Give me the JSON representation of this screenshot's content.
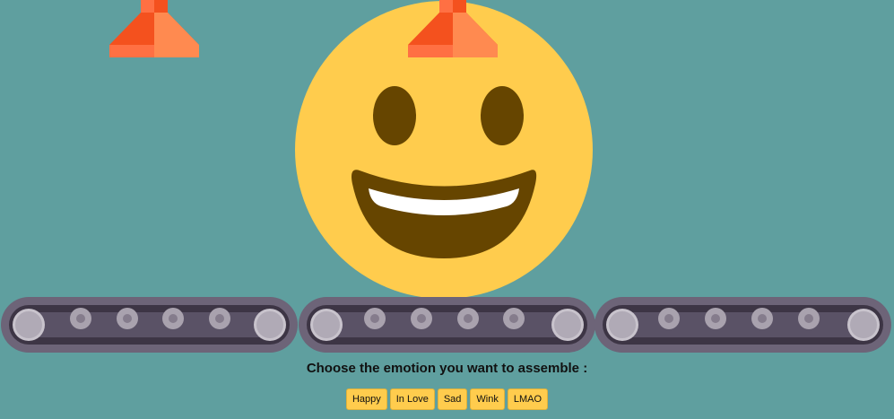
{
  "prompt": "Choose the emotion you want to assemble :",
  "buttons": [
    "Happy",
    "In Love",
    "Sad",
    "Wink",
    "LMAO"
  ],
  "colors": {
    "background": "#5f9f9f",
    "emoji_face": "#ffcc4d",
    "emoji_features": "#664500",
    "dispenser_light": "#ff7043",
    "dispenser_dark": "#f4511e",
    "belt": "#6d6478",
    "roller": "#c8c3cc"
  },
  "selected_emotion": "Happy"
}
